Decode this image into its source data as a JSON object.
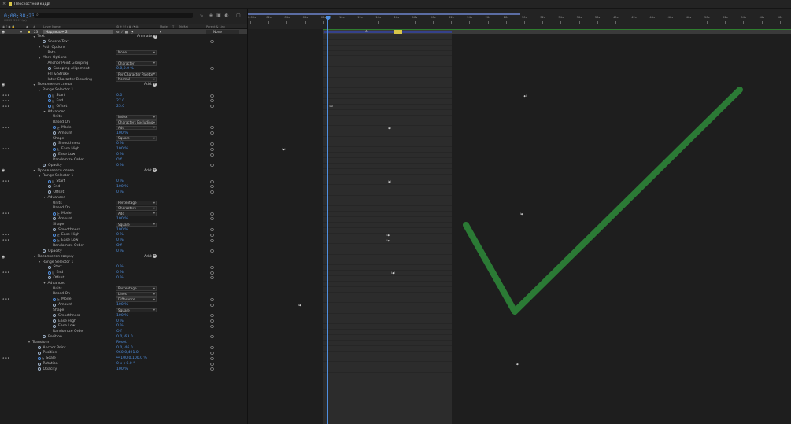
{
  "window": {
    "title": "Плоскостной кадр",
    "close": "×",
    "menu": "≡"
  },
  "toolbar": {
    "timecode": "0;00;08;23",
    "frames": "00263 (29.97 fps)",
    "search_icon": "⌕"
  },
  "columns": {
    "layer_name": "Layer Name",
    "mode": "Mode",
    "t": "T",
    "trkmat": "TrkMat",
    "parent": "Parent & Link"
  },
  "layer": {
    "number": "23",
    "name": "Надпись ↵ 2",
    "parent": "None"
  },
  "ruler": [
    "0:00s",
    "02s",
    "04s",
    "06s",
    "08s",
    "10s",
    "12s",
    "14s",
    "16s",
    "18s",
    "20s",
    "22s",
    "24s",
    "26s",
    "28s",
    "30s",
    "32s",
    "34s",
    "36s",
    "38s",
    "40s",
    "42s",
    "44s",
    "46s",
    "48s",
    "50s",
    "52s",
    "54s",
    "56s",
    "58s"
  ],
  "properties": [
    {
      "indent": 1,
      "twirl": "▾",
      "name": "Text",
      "animate": "Animate:"
    },
    {
      "indent": 2,
      "sw": true,
      "name": "Source Text",
      "link": true
    },
    {
      "indent": 2,
      "twirl": "▾",
      "name": "Path Options"
    },
    {
      "indent": 3,
      "name": "Path",
      "dd": "None"
    },
    {
      "indent": 2,
      "twirl": "▾",
      "name": "More Options"
    },
    {
      "indent": 3,
      "name": "Anchor Point Grouping",
      "dd": "Character"
    },
    {
      "indent": 3,
      "sw": true,
      "name": "Grouping Alignment",
      "val": "0.0,0.0 %",
      "link": true
    },
    {
      "indent": 3,
      "name": "Fill & Stroke",
      "dd": "Per Character Palette"
    },
    {
      "indent": 3,
      "name": "Inter-Character Blending",
      "dd": "Normal"
    },
    {
      "indent": 1,
      "eye": true,
      "twirl": "▾",
      "name": "Появляется слева",
      "add": "Add:"
    },
    {
      "indent": 2,
      "twirl": "▾",
      "name": "Range Selector 1"
    },
    {
      "indent": 3,
      "kf": true,
      "sw": true,
      "on": true,
      "name": "Start",
      "val": "0.0",
      "link": true
    },
    {
      "indent": 3,
      "kf": true,
      "sw": true,
      "on": true,
      "name": "End",
      "val": "27.0",
      "link": true
    },
    {
      "indent": 3,
      "kf": true,
      "sw": true,
      "on": true,
      "name": "Offset",
      "val": "25.0",
      "link": true
    },
    {
      "indent": 3,
      "twirl": "▾",
      "name": "Advanced"
    },
    {
      "indent": 4,
      "name": "Units",
      "dd": "Index"
    },
    {
      "indent": 4,
      "name": "Based On",
      "dd": "Characters Excluding"
    },
    {
      "indent": 4,
      "kf": true,
      "sw": true,
      "on": true,
      "name": "Mode",
      "dd": "Add",
      "link": true
    },
    {
      "indent": 4,
      "sw": true,
      "name": "Amount",
      "val": "100 %",
      "link": true
    },
    {
      "indent": 4,
      "name": "Shape",
      "dd": "Square"
    },
    {
      "indent": 4,
      "sw": true,
      "name": "Smoothness",
      "val": "0 %",
      "link": true
    },
    {
      "indent": 4,
      "kf": true,
      "sw": true,
      "on": true,
      "name": "Ease High",
      "val": "100 %",
      "link": true
    },
    {
      "indent": 4,
      "sw": true,
      "name": "Ease Low",
      "val": "0 %",
      "link": true
    },
    {
      "indent": 4,
      "name": "Randomize Order",
      "val": "Off"
    },
    {
      "indent": 2,
      "sw": true,
      "name": "Opacity",
      "val": "0 %",
      "link": true
    },
    {
      "indent": 1,
      "eye": true,
      "twirl": "▾",
      "name": "Проявляется слева",
      "add": "Add:"
    },
    {
      "indent": 2,
      "twirl": "▾",
      "name": "Range Selector 1"
    },
    {
      "indent": 3,
      "kf": true,
      "sw": true,
      "on": true,
      "name": "Start",
      "val": "0 %",
      "link": true
    },
    {
      "indent": 3,
      "sw": true,
      "name": "End",
      "val": "100 %",
      "link": true
    },
    {
      "indent": 3,
      "sw": true,
      "name": "Offset",
      "val": "0 %",
      "link": true
    },
    {
      "indent": 3,
      "twirl": "▾",
      "name": "Advanced"
    },
    {
      "indent": 4,
      "name": "Units",
      "dd": "Percentage"
    },
    {
      "indent": 4,
      "name": "Based On",
      "dd": "Characters"
    },
    {
      "indent": 4,
      "kf": true,
      "sw": true,
      "on": true,
      "name": "Mode",
      "dd": "Add",
      "link": true
    },
    {
      "indent": 4,
      "sw": true,
      "name": "Amount",
      "val": "100 %",
      "link": true
    },
    {
      "indent": 4,
      "name": "Shape",
      "dd": "Square"
    },
    {
      "indent": 4,
      "sw": true,
      "name": "Smoothness",
      "val": "100 %",
      "link": true
    },
    {
      "indent": 4,
      "kf": true,
      "sw": true,
      "on": true,
      "name": "Ease High",
      "val": "0 %",
      "link": true
    },
    {
      "indent": 4,
      "kf": true,
      "sw": true,
      "on": true,
      "name": "Ease Low",
      "val": "0 %",
      "link": true
    },
    {
      "indent": 4,
      "name": "Randomize Order",
      "val": "Off"
    },
    {
      "indent": 2,
      "sw": true,
      "name": "Opacity",
      "val": "0 %",
      "link": true
    },
    {
      "indent": 1,
      "eye": true,
      "twirl": "▾",
      "name": "Появляется сверху",
      "add": "Add:"
    },
    {
      "indent": 2,
      "twirl": "▾",
      "name": "Range Selector 1"
    },
    {
      "indent": 3,
      "sw": true,
      "name": "Start",
      "val": "0 %",
      "link": true
    },
    {
      "indent": 3,
      "kf": true,
      "sw": true,
      "on": true,
      "name": "End",
      "val": "0 %",
      "link": true
    },
    {
      "indent": 3,
      "sw": true,
      "name": "Offset",
      "val": "0 %",
      "link": true
    },
    {
      "indent": 3,
      "twirl": "▾",
      "name": "Advanced"
    },
    {
      "indent": 4,
      "name": "Units",
      "dd": "Percentage"
    },
    {
      "indent": 4,
      "name": "Based On",
      "dd": "Lines"
    },
    {
      "indent": 4,
      "kf": true,
      "sw": true,
      "on": true,
      "name": "Mode",
      "dd": "Difference",
      "link": true
    },
    {
      "indent": 4,
      "sw": true,
      "name": "Amount",
      "val": "100 %",
      "link": true
    },
    {
      "indent": 4,
      "name": "Shape",
      "dd": "Square"
    },
    {
      "indent": 4,
      "sw": true,
      "name": "Smoothness",
      "val": "100 %",
      "link": true
    },
    {
      "indent": 4,
      "sw": true,
      "name": "Ease High",
      "val": "0 %",
      "link": true
    },
    {
      "indent": 4,
      "sw": true,
      "name": "Ease Low",
      "val": "0 %",
      "link": true
    },
    {
      "indent": 4,
      "name": "Randomize Order",
      "val": "Off"
    },
    {
      "indent": 2,
      "sw": true,
      "name": "Position",
      "val": "0.0,-63.0",
      "link": true
    },
    {
      "indent": 0,
      "twirl": "▾",
      "name": "Transform",
      "val": "Reset"
    },
    {
      "indent": 1,
      "sw": true,
      "name": "Anchor Point",
      "val": "0.0,-46.0",
      "link": true
    },
    {
      "indent": 1,
      "sw": true,
      "name": "Position",
      "val": "960.0,491.0",
      "link": true
    },
    {
      "indent": 1,
      "kf": true,
      "sw": true,
      "on": true,
      "name": "Scale",
      "val": "⚯ 100.0,100.0 %",
      "link": true
    },
    {
      "indent": 1,
      "sw": true,
      "name": "Rotation",
      "val": "0 x +0.0 °",
      "link": true
    },
    {
      "indent": 1,
      "sw": true,
      "name": "Opacity",
      "val": "100 %",
      "link": true
    }
  ],
  "keyframes": [
    {
      "row": 11,
      "t": 21.6
    },
    {
      "row": 13,
      "t": 0.4
    },
    {
      "row": 17,
      "t": 6.8
    },
    {
      "row": 21,
      "t": -4.8
    },
    {
      "row": 27,
      "t": 6.8
    },
    {
      "row": 33,
      "t": 21.3
    },
    {
      "row": 37,
      "t": 6.7
    },
    {
      "row": 38,
      "t": 6.7
    },
    {
      "row": 44,
      "t": 7.2
    },
    {
      "row": 50,
      "t": -3.0
    },
    {
      "row": 61,
      "t": 20.8
    }
  ],
  "checkmark_color": "#2e8b3a"
}
